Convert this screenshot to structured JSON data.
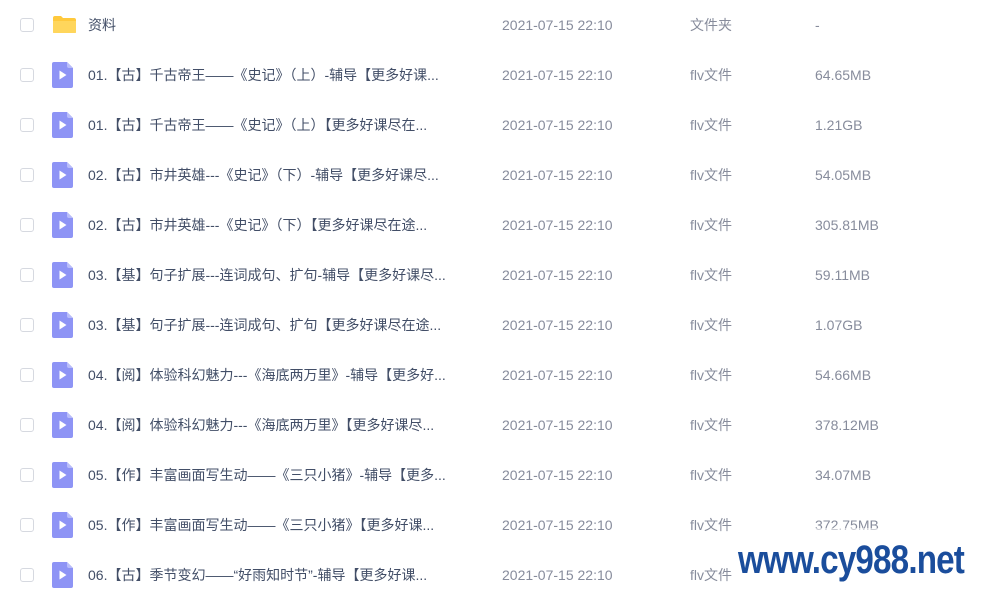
{
  "files": [
    {
      "name": "资料",
      "time": "2021-07-15 22:10",
      "type": "文件夹",
      "size": "-",
      "icon": "folder-icon"
    },
    {
      "name": "01.【古】千古帝王——《史记》（上）-辅导【更多好课...",
      "time": "2021-07-15 22:10",
      "type": "flv文件",
      "size": "64.65MB",
      "icon": "video-file-icon"
    },
    {
      "name": "01.【古】千古帝王——《史记》（上）【更多好课尽在...",
      "time": "2021-07-15 22:10",
      "type": "flv文件",
      "size": "1.21GB",
      "icon": "video-file-icon"
    },
    {
      "name": "02.【古】市井英雄---《史记》（下）-辅导【更多好课尽...",
      "time": "2021-07-15 22:10",
      "type": "flv文件",
      "size": "54.05MB",
      "icon": "video-file-icon"
    },
    {
      "name": "02.【古】市井英雄---《史记》（下）【更多好课尽在途...",
      "time": "2021-07-15 22:10",
      "type": "flv文件",
      "size": "305.81MB",
      "icon": "video-file-icon"
    },
    {
      "name": "03.【基】句子扩展---连词成句、扩句-辅导【更多好课尽...",
      "time": "2021-07-15 22:10",
      "type": "flv文件",
      "size": "59.11MB",
      "icon": "video-file-icon"
    },
    {
      "name": "03.【基】句子扩展---连词成句、扩句【更多好课尽在途...",
      "time": "2021-07-15 22:10",
      "type": "flv文件",
      "size": "1.07GB",
      "icon": "video-file-icon"
    },
    {
      "name": "04.【阅】体验科幻魅力---《海底两万里》-辅导【更多好...",
      "time": "2021-07-15 22:10",
      "type": "flv文件",
      "size": "54.66MB",
      "icon": "video-file-icon"
    },
    {
      "name": "04.【阅】体验科幻魅力---《海底两万里》【更多好课尽...",
      "time": "2021-07-15 22:10",
      "type": "flv文件",
      "size": "378.12MB",
      "icon": "video-file-icon"
    },
    {
      "name": "05.【作】丰富画面写生动——《三只小猪》-辅导【更多...",
      "time": "2021-07-15 22:10",
      "type": "flv文件",
      "size": "34.07MB",
      "icon": "video-file-icon"
    },
    {
      "name": "05.【作】丰富画面写生动——《三只小猪》【更多好课...",
      "time": "2021-07-15 22:10",
      "type": "flv文件",
      "size": "372.75MB",
      "icon": "video-file-icon"
    },
    {
      "name": "06.【古】季节变幻——“好雨知时节”-辅导【更多好课...",
      "time": "2021-07-15 22:10",
      "type": "flv文件",
      "size": "",
      "icon": "video-file-icon"
    }
  ],
  "watermark": "www.cy988.net",
  "colors": {
    "folder": "#ffc93c",
    "video_icon": "#8e94f5",
    "text_primary": "#424e67",
    "text_secondary": "#878c9c",
    "watermark": "#1a4d9c"
  }
}
